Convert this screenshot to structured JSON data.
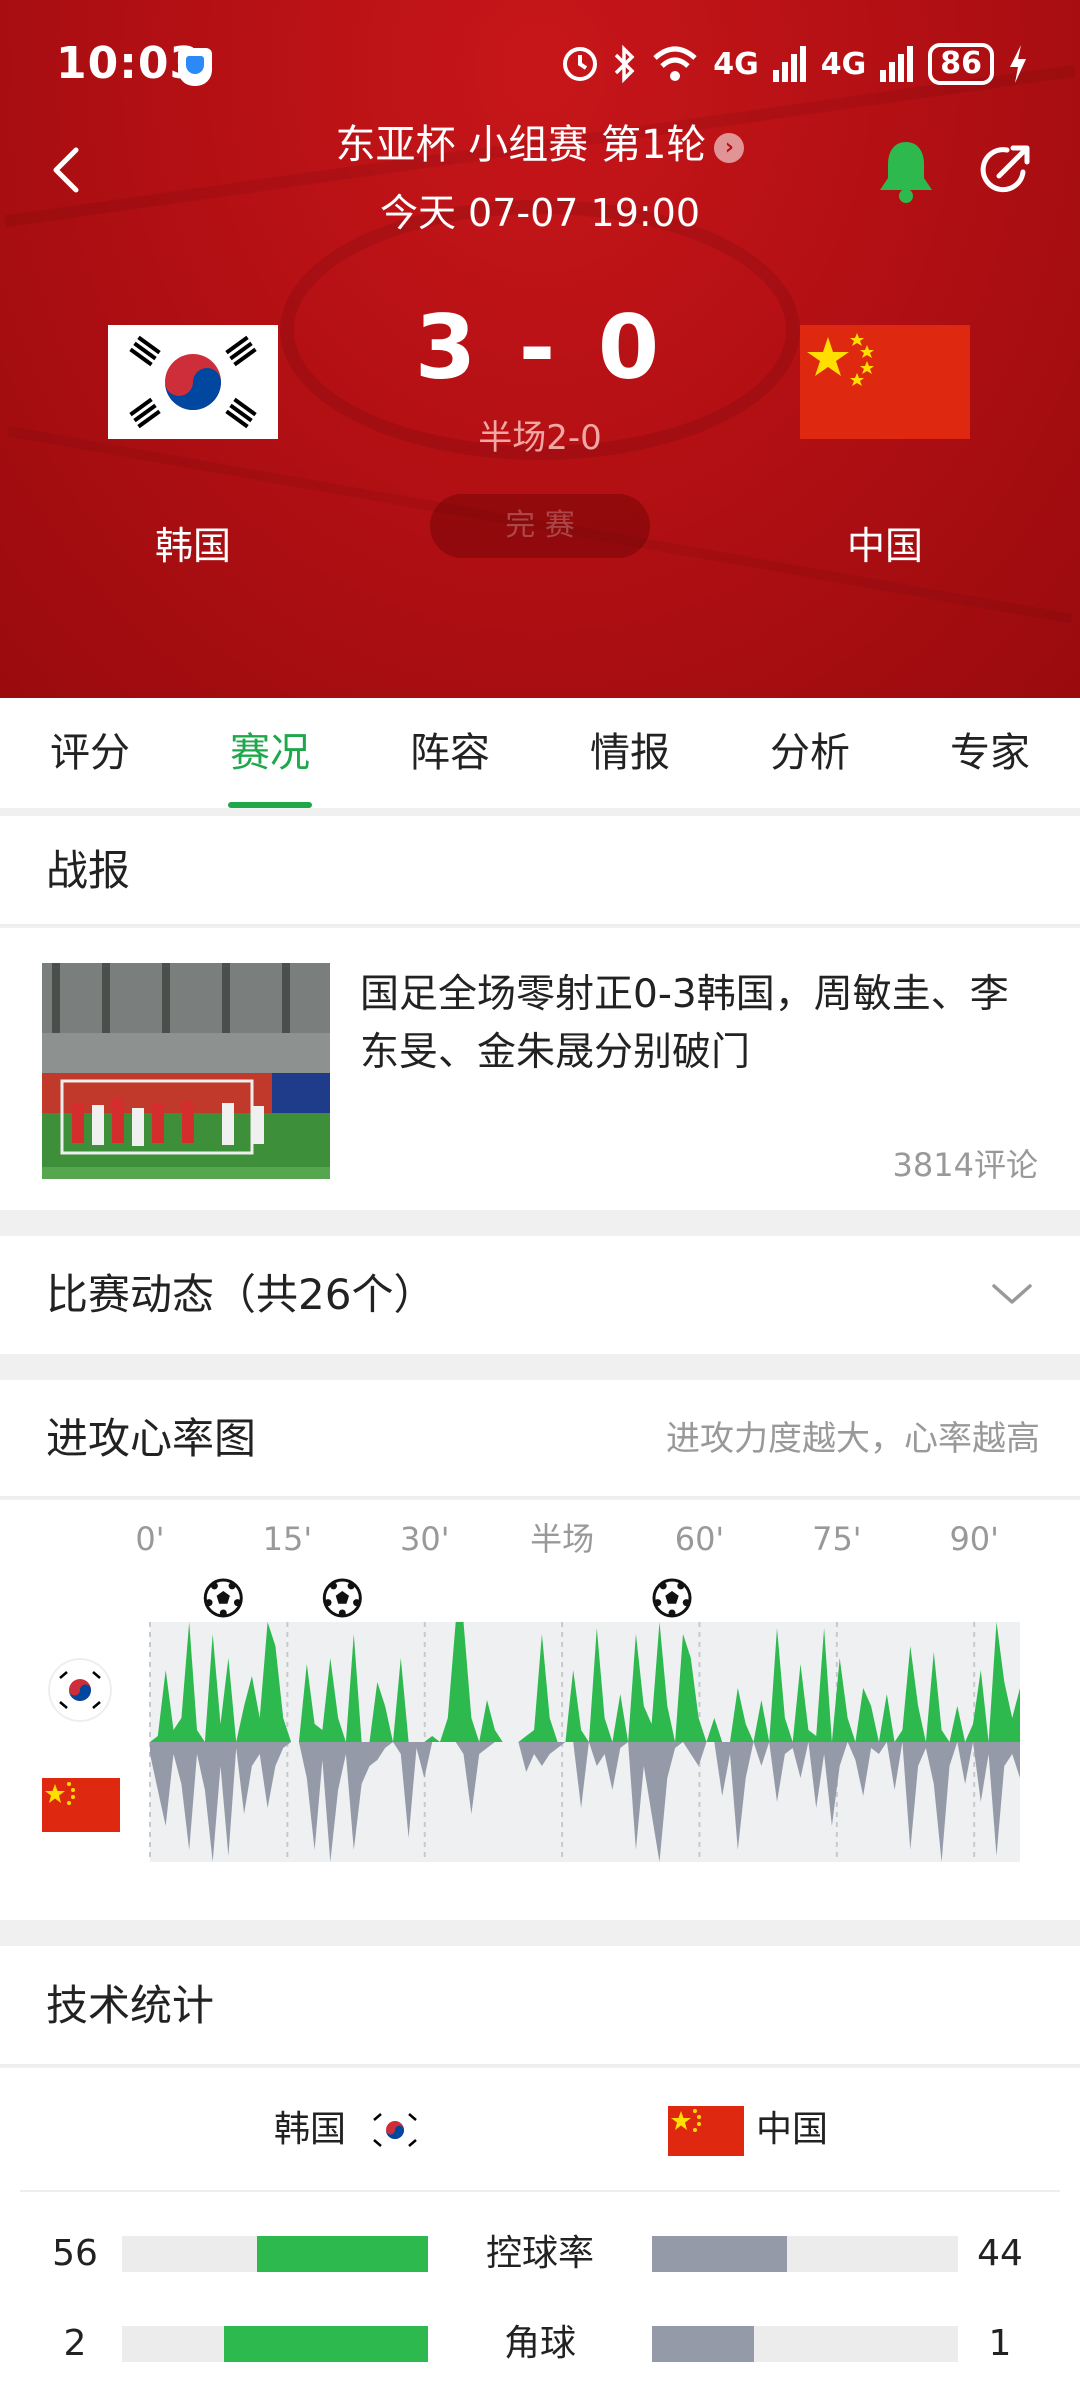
{
  "status_bar": {
    "time": "10:03",
    "network": "4G",
    "battery": "86"
  },
  "match": {
    "title": "东亚杯 小组赛 第1轮",
    "datetime": "今天 07-07 19:00",
    "score": "3 - 0",
    "halftime": "半场2-0",
    "home_team": "韩国",
    "away_team": "中国",
    "status_pill": "完 赛"
  },
  "tabs": [
    "评分",
    "赛况",
    "阵容",
    "情报",
    "分析",
    "专家"
  ],
  "active_tab": 1,
  "report": {
    "section_title": "战报",
    "headline": "国足全场零射正0-3韩国，周敏圭、李东旻、金朱晟分别破门",
    "comments": "3814评论"
  },
  "events": {
    "title": "比赛动态（共26个）"
  },
  "heart_rate": {
    "title": "进攻心率图",
    "hint": "进攻力度越大，心率越高",
    "time_labels": [
      "0'",
      "15'",
      "30'",
      "半场",
      "60'",
      "75'",
      "90'"
    ],
    "goal_minutes": [
      8,
      21,
      57
    ],
    "home_color": "#2db94d",
    "away_color": "#959aa8",
    "home_pressure": [
      0,
      0.05,
      0.6,
      0.1,
      0.2,
      1.0,
      0.1,
      0,
      0.9,
      0.15,
      0.7,
      0,
      0.3,
      0.55,
      0.2,
      1.0,
      0.8,
      0.2,
      0,
      0,
      0.65,
      0.15,
      0.1,
      0.7,
      0.2,
      0,
      0.9,
      0,
      0,
      0.5,
      0.3,
      0,
      0.7,
      0,
      0,
      0,
      0.05,
      0,
      0.2,
      1.0,
      1.0,
      0.2,
      0,
      0.35,
      0.1,
      0,
      0,
      0,
      0.05,
      0.1,
      0.9,
      0.2,
      0,
      0,
      0.6,
      0.1,
      0,
      0.95,
      0.2,
      0,
      0.4,
      0,
      0.9,
      0.3,
      0.15,
      1.0,
      0.3,
      0,
      0.9,
      0.7,
      0.2,
      0,
      0.2,
      0,
      0,
      0.45,
      0.15,
      0,
      0.35,
      0,
      0.95,
      0.2,
      0,
      0.65,
      0.1,
      0.05,
      0.95,
      0,
      0.7,
      0.2,
      0,
      0.45,
      0.3,
      0,
      0.4,
      0,
      0.1,
      0.8,
      0.3,
      0,
      0.75,
      0.1,
      0,
      0.3,
      0,
      0.15,
      0.6,
      0,
      1.0,
      0.5,
      0.2,
      0.45
    ],
    "away_pressure": [
      0.1,
      0.4,
      0.7,
      0.1,
      0.35,
      0.9,
      0.1,
      0.4,
      1.0,
      0.2,
      0.95,
      0.05,
      0.6,
      0.2,
      0.1,
      0.55,
      0.2,
      0.05,
      0,
      0,
      0.3,
      0.9,
      0.15,
      1.0,
      0.4,
      0.1,
      0.9,
      0.35,
      0.2,
      0.15,
      0.05,
      0,
      0.1,
      0.8,
      0.05,
      0.3,
      0,
      0,
      0,
      0,
      0.1,
      0.6,
      0.1,
      0.05,
      0,
      0,
      0,
      0,
      0.25,
      0.1,
      0.2,
      0.1,
      0.05,
      0,
      0,
      0.55,
      0,
      0.2,
      0.1,
      0.4,
      0.05,
      0,
      0.9,
      0.2,
      0.6,
      1.0,
      0.3,
      0.05,
      0,
      0.1,
      0.2,
      0,
      0,
      0.45,
      0.1,
      0.9,
      0.3,
      0,
      0.2,
      0,
      0.5,
      0.1,
      0.05,
      0.3,
      0,
      0.55,
      0.1,
      0.7,
      0.2,
      0,
      0.15,
      0.45,
      0.05,
      0.1,
      0,
      0.4,
      0,
      0.9,
      0.2,
      0.05,
      0.35,
      1.0,
      0.2,
      0,
      0.35,
      0,
      0.5,
      0.1,
      0.95,
      0.2,
      0.1,
      0.3
    ]
  },
  "stats": {
    "title": "技术统计",
    "home_name": "韩国",
    "away_name": "中国",
    "rows": [
      {
        "label": "控球率",
        "home": "56",
        "away": "44",
        "home_ratio": 0.56,
        "away_ratio": 0.44
      },
      {
        "label": "角球",
        "home": "2",
        "away": "1",
        "home_ratio": 0.667,
        "away_ratio": 0.333
      }
    ]
  }
}
